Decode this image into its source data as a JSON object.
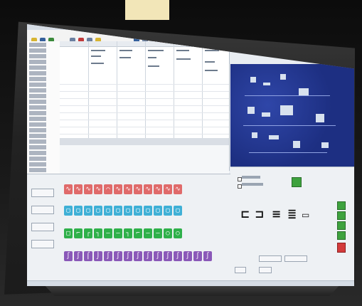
{
  "colors": {
    "background": "#111111",
    "tag": "#f2e6b8",
    "screen": "#e9edf2",
    "board": "#1d2f82",
    "accent_red": "#e06060",
    "accent_blue": "#38a8d0",
    "accent_green": "#2fb04a",
    "accent_purple": "#8a58b8",
    "button_green": "#3ea23e",
    "button_red": "#d33b3b"
  },
  "toolbar": {
    "icons": [
      "yellow-tool-icon",
      "blue-tool-icon",
      "green-tool-icon",
      "red-tool-icon",
      "line-tool-icon",
      "wire-tool-icon"
    ]
  },
  "palette_rows": [
    {
      "name": "red-row",
      "color": "#e06a6a",
      "glyphs": [
        "∿",
        "∿",
        "∿",
        "∿",
        "⌒",
        "∿",
        "∿",
        "∿",
        "∿",
        "∿",
        "∿",
        "∿"
      ]
    },
    {
      "name": "blue-row",
      "color": "#3fb0d6",
      "glyphs": [
        "▢",
        "▢",
        "▢",
        "▢",
        "▢",
        "▢",
        "▢",
        "▢",
        "▢",
        "▢",
        "▢",
        "▢"
      ]
    },
    {
      "name": "green-row",
      "color": "#2fb04a",
      "glyphs": [
        "□",
        "⌐",
        "┌",
        "┐",
        "—",
        "—",
        "┐",
        "⌐",
        "—",
        "—",
        "○",
        "○"
      ]
    },
    {
      "name": "purple-row",
      "color": "#8a58b8",
      "glyphs": [
        "∫",
        "∫",
        "⌠",
        "⌡",
        "∫",
        "∫",
        "∫",
        "∫",
        "∫",
        "∫",
        "∫",
        "∫",
        "∫",
        "∫",
        "∫"
      ]
    }
  ]
}
